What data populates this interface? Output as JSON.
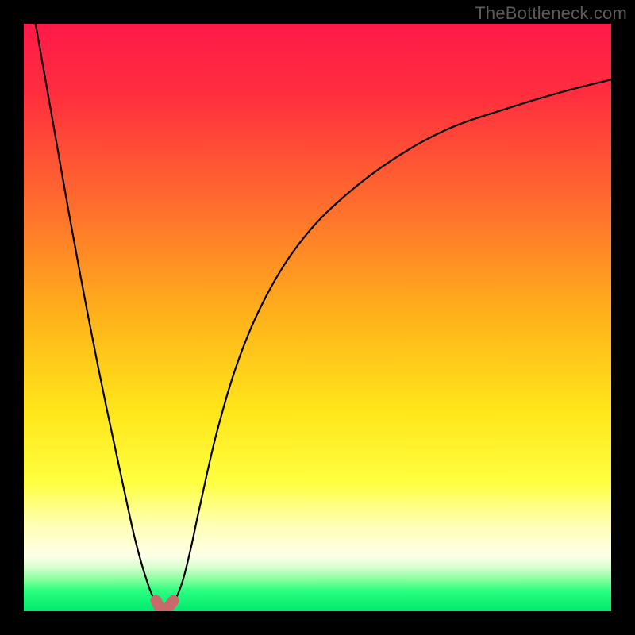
{
  "watermark": "TheBottleneck.com",
  "colors": {
    "frame": "#000000",
    "gradient_stops": [
      {
        "offset": 0.0,
        "color": "#ff1a49"
      },
      {
        "offset": 0.12,
        "color": "#ff2e3e"
      },
      {
        "offset": 0.3,
        "color": "#ff6a2e"
      },
      {
        "offset": 0.5,
        "color": "#ffb31a"
      },
      {
        "offset": 0.66,
        "color": "#ffe61a"
      },
      {
        "offset": 0.78,
        "color": "#ffff40"
      },
      {
        "offset": 0.85,
        "color": "#feffb0"
      },
      {
        "offset": 0.905,
        "color": "#ffffe8"
      },
      {
        "offset": 0.925,
        "color": "#d7ffcf"
      },
      {
        "offset": 0.945,
        "color": "#8bff9e"
      },
      {
        "offset": 0.965,
        "color": "#2bff80"
      },
      {
        "offset": 1.0,
        "color": "#00e96e"
      }
    ],
    "curve": "#000000",
    "marker_fill": "#c86a6a",
    "marker_stroke": "#b45656"
  },
  "chart_data": {
    "type": "line",
    "title": "",
    "xlabel": "",
    "ylabel": "",
    "xlim": [
      0,
      100
    ],
    "ylim": [
      0,
      100
    ],
    "grid": false,
    "legend": false,
    "series": [
      {
        "name": "bottleneck-curve",
        "x": [
          2,
          5,
          8,
          11,
          14,
          17,
          19,
          21,
          22.5,
          24,
          25.5,
          27,
          28.5,
          30,
          33,
          37,
          42,
          48,
          55,
          63,
          72,
          82,
          92,
          100
        ],
        "y": [
          100,
          83,
          66,
          50,
          35,
          21,
          12,
          5,
          1.5,
          0,
          1.5,
          5,
          11,
          18,
          31,
          44,
          55,
          64,
          71,
          77,
          82,
          85.5,
          88.5,
          90.5
        ]
      }
    ],
    "valley_markers": {
      "x": [
        22.5,
        23.0,
        24.0,
        24.7,
        25.5
      ],
      "y": [
        1.8,
        0.8,
        0.2,
        0.8,
        1.8
      ]
    },
    "notes": "y represents bottleneck percentage; minimum (optimal match) occurs near x≈24."
  }
}
